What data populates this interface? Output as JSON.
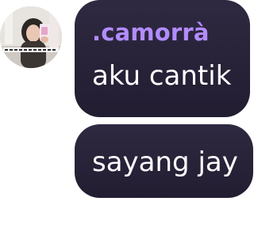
{
  "chat": {
    "sender": {
      "name": ".camorrà",
      "name_color": "#b28cff"
    },
    "messages": [
      {
        "text": "aku cantik"
      },
      {
        "text": "sayang jay"
      }
    ],
    "bubble_color": "#2a2439",
    "text_color": "#ffffff"
  }
}
